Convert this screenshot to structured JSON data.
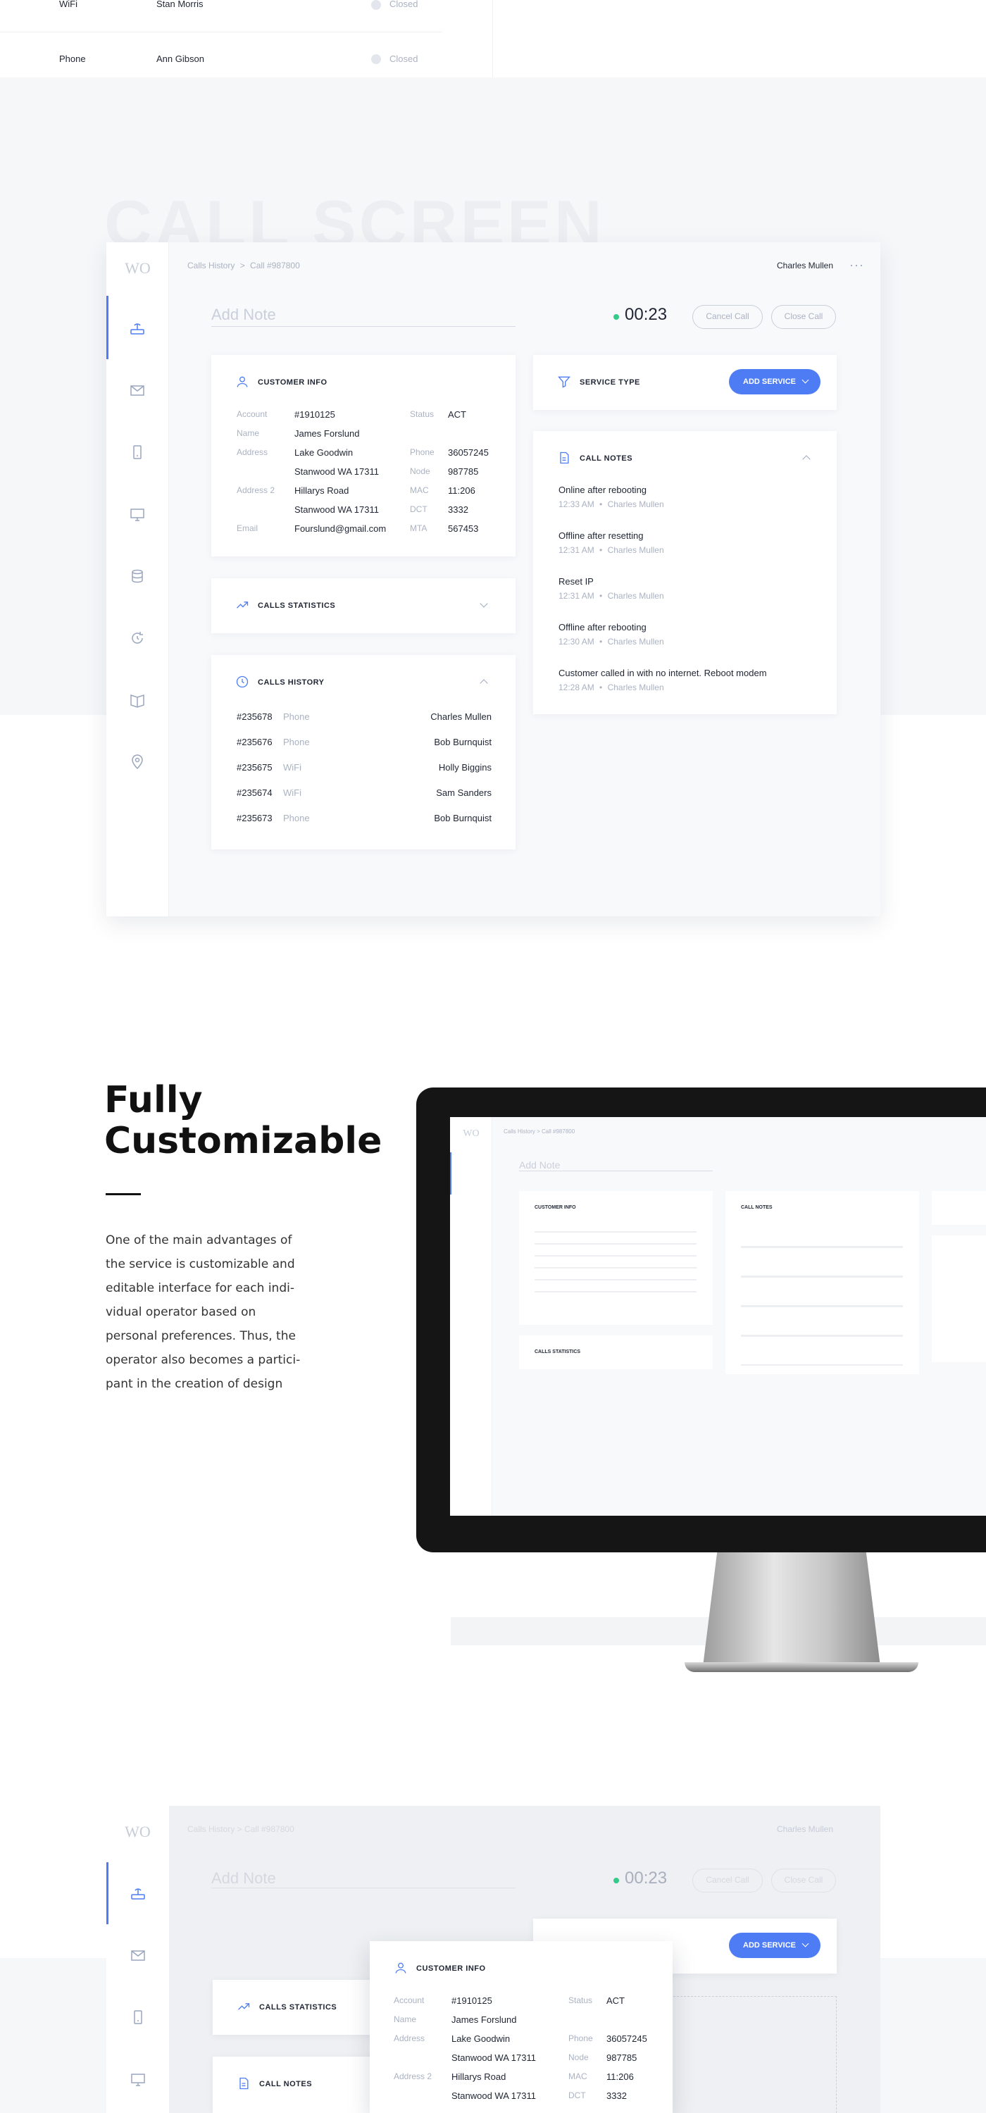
{
  "top_rows": [
    {
      "type": "WiFi",
      "name": "Stan Morris",
      "status": "Closed"
    },
    {
      "type": "Phone",
      "name": "Ann Gibson",
      "status": "Closed"
    }
  ],
  "section_title": "CALL SCREEN",
  "logo": "WO",
  "breadcrumb": {
    "root": "Calls History",
    "sep": ">",
    "current": "Call #987800"
  },
  "user_name": "Charles Mullen",
  "add_note_placeholder": "Add Note",
  "timer": "00:23",
  "cancel_call": "Cancel Call",
  "close_call": "Close Call",
  "customer_info": {
    "title": "CUSTOMER INFO",
    "labels": {
      "account": "Account",
      "name": "Name",
      "address": "Address",
      "address2": "Address 2",
      "email": "Email",
      "status": "Status",
      "phone": "Phone",
      "node": "Node",
      "mac": "MAC",
      "dct": "DCT",
      "mta": "MTA"
    },
    "values": {
      "account": "#1910125",
      "name": "James Forslund",
      "address_l1": "Lake Goodwin",
      "address_l2": "Stanwood WA 17311",
      "address2_l1": "Hillarys Road",
      "address2_l2": "Stanwood WA 17311",
      "email": "Fourslund@gmail.com",
      "status": "ACT",
      "phone": "36057245",
      "node": "987785",
      "mac": "11:206",
      "dct": "3332",
      "mta": "567453"
    }
  },
  "calls_statistics": "CALLS STATISTICS",
  "calls_history": {
    "title": "CALLS HISTORY",
    "rows": [
      {
        "id": "#235678",
        "type": "Phone",
        "name": "Charles Mullen"
      },
      {
        "id": "#235676",
        "type": "Phone",
        "name": "Bob Burnquist"
      },
      {
        "id": "#235675",
        "type": "WiFi",
        "name": "Holly Biggins"
      },
      {
        "id": "#235674",
        "type": "WiFi",
        "name": "Sam Sanders"
      },
      {
        "id": "#235673",
        "type": "Phone",
        "name": "Bob Burnquist"
      }
    ]
  },
  "service_type": "SERVICE TYPE",
  "add_service": "ADD SERVICE",
  "call_notes": {
    "title": "CALL NOTES",
    "notes": [
      {
        "text": "Online after rebooting",
        "time": "12:33 AM",
        "author": "Charles Mullen"
      },
      {
        "text": "Offline after resetting",
        "time": "12:31 AM",
        "author": "Charles Mullen"
      },
      {
        "text": "Reset IP",
        "time": "12:31 AM",
        "author": "Charles Mullen"
      },
      {
        "text": "Offline after rebooting",
        "time": "12:30 AM",
        "author": "Charles Mullen"
      },
      {
        "text": "Customer called in with no internet. Reboot modem",
        "time": "12:28 AM",
        "author": "Charles Mullen"
      }
    ]
  },
  "sep_dot": "•",
  "promo": {
    "title_l1": "Fully",
    "title_l2": "Customizable",
    "body": [
      "One of the main advantages of",
      "the service is customizable and",
      "editable interface for each indi-",
      "vidual operator based on",
      "personal preferences. Thus, the",
      "operator also becomes a partici-",
      "pant in the creation of design"
    ]
  },
  "colors": {
    "accent": "#4d7cf4",
    "sidebar": "#f4f5f8",
    "bg_band": "#f6f7f9",
    "online": "#35c98a"
  }
}
